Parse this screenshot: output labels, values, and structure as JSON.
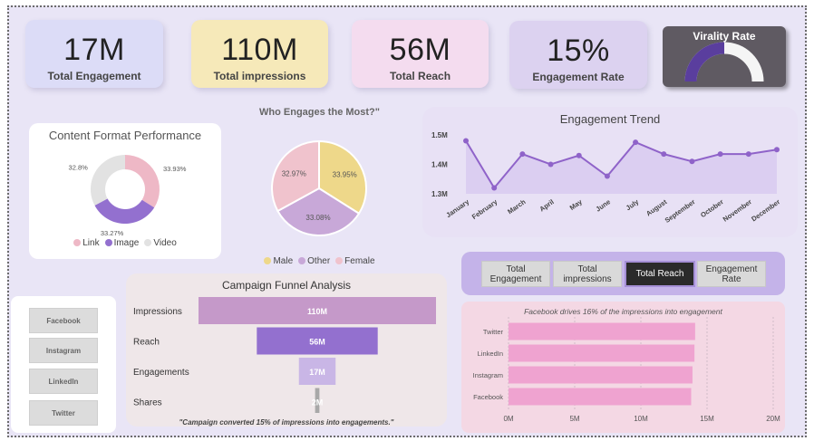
{
  "kpis": [
    {
      "value": "17M",
      "label": "Total Engagement",
      "bg": "#dcdcf7"
    },
    {
      "value": "110M",
      "label": "Total impressions",
      "bg": "#f6e9b9"
    },
    {
      "value": "56M",
      "label": "Total Reach",
      "bg": "#f4dcef"
    },
    {
      "value": "15%",
      "label": "Engagement Rate",
      "bg": "#dcd2f0"
    }
  ],
  "virality": {
    "title": "Virality Rate",
    "bg": "#5f5a62",
    "gauge_color": "#5a3e9e",
    "track_color": "#f5f5f5"
  },
  "colors": {
    "lavender": "#c599c9",
    "purple": "#9370cf",
    "lightpurple": "#c9b6e6",
    "pink": "#efa3d0",
    "gray": "#a8a8a8",
    "line": "#8f63c9"
  },
  "chart_data": [
    {
      "type": "pie",
      "title": "Content Format Performance",
      "donut": true,
      "labels": [
        "Link",
        "Image",
        "Video"
      ],
      "values": [
        33.93,
        33.27,
        32.8
      ],
      "value_labels": [
        "33.93%",
        "33.27%",
        "32.8%"
      ],
      "colors": [
        "#eeb8c6",
        "#9370cf",
        "#e2e2e2"
      ],
      "legend_position": "bottom"
    },
    {
      "type": "pie",
      "title": "Who Engages the Most?\"",
      "labels": [
        "Male",
        "Other",
        "Female"
      ],
      "values": [
        33.95,
        33.08,
        32.97
      ],
      "value_labels": [
        "33.95%",
        "33.08%",
        "32.97%"
      ],
      "colors": [
        "#eed88a",
        "#c8a8d8",
        "#f0c3cd"
      ],
      "legend_position": "bottom"
    },
    {
      "type": "area",
      "title": "Engagement Trend",
      "categories": [
        "January",
        "February",
        "March",
        "April",
        "May",
        "June",
        "July",
        "August",
        "September",
        "October",
        "November",
        "December"
      ],
      "values": [
        1.48,
        1.32,
        1.435,
        1.4,
        1.43,
        1.36,
        1.475,
        1.435,
        1.41,
        1.435,
        1.435,
        1.45
      ],
      "yticks": [
        "1.3M",
        "1.4M",
        "1.5M"
      ],
      "ytick_values": [
        1.3,
        1.4,
        1.5
      ],
      "ylim": [
        1.3,
        1.5
      ],
      "grid": false
    },
    {
      "type": "bar",
      "orientation": "horizontal",
      "title": "Campaign Funnel Analysis",
      "categories": [
        "Impressions",
        "Reach",
        "Engagements",
        "Shares"
      ],
      "values": [
        110,
        56,
        17,
        2
      ],
      "value_labels": [
        "110M",
        "56M",
        "17M",
        "2M"
      ],
      "colors": [
        "#c599c9",
        "#9370cf",
        "#c9b6e6",
        "#a8a8a8"
      ],
      "annotation": "\"Campaign converted 15% of impressions into engagements.\""
    },
    {
      "type": "bar",
      "orientation": "horizontal",
      "subtitle": "Facebook drives 16% of the impressions into engagement",
      "categories": [
        "Twitter",
        "LinkedIn",
        "Instagram",
        "Facebook"
      ],
      "values": [
        14.1,
        14.05,
        13.9,
        13.8
      ],
      "xticks": [
        "0M",
        "5M",
        "10M",
        "15M",
        "20M"
      ],
      "xtick_values": [
        0,
        5,
        10,
        15,
        20
      ],
      "xlim": [
        0,
        20
      ],
      "grid": true,
      "color": "#efa3d0"
    }
  ],
  "slicer": [
    "Facebook",
    "Instagram",
    "LinkedIn",
    "Twitter"
  ],
  "tabs": {
    "items": [
      "Total Engagement",
      "Total impressions",
      "Total Reach",
      "Engagement Rate"
    ],
    "active": "Total Reach"
  }
}
